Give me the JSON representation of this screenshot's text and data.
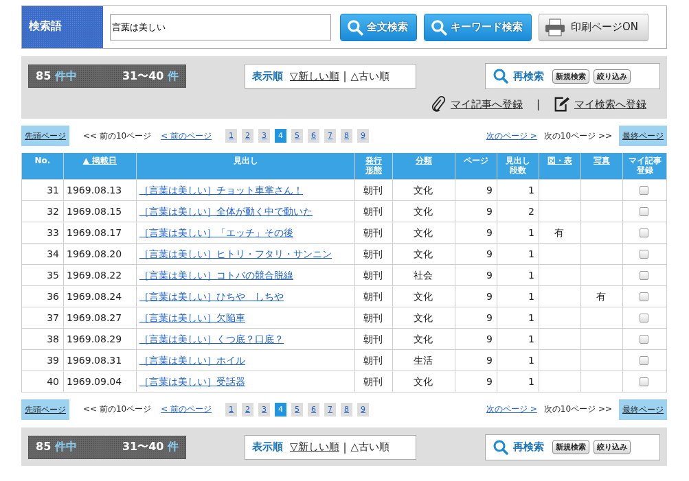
{
  "search": {
    "label": "検索語",
    "value": "言葉は美しい",
    "buttons": [
      {
        "kind": "search",
        "label": "全文検索"
      },
      {
        "kind": "search",
        "label": "キーワード検索"
      },
      {
        "kind": "print",
        "label": "印刷ページON"
      }
    ]
  },
  "result_bars": [
    {
      "total": "85",
      "total_unit": "件中",
      "range": "31〜40",
      "range_unit": "件",
      "sort_label": "表示順",
      "sort_options": [
        {
          "label": "▽新しい順",
          "selected": false
        },
        {
          "label": "△古い順",
          "selected": true
        }
      ],
      "sort_separator": "|",
      "research_label": "再検索",
      "research_buttons": [
        "新規検索",
        "絞り込み"
      ],
      "register_links": [
        {
          "kind": "clip",
          "label": "マイ記事へ登録"
        },
        {
          "kind": "note",
          "label": "マイ検索へ登録"
        }
      ],
      "register_separator": "|"
    },
    {
      "total": "85",
      "total_unit": "件中",
      "range": "31〜40",
      "range_unit": "件",
      "sort_label": "表示順",
      "sort_options": [
        {
          "label": "▽新しい順",
          "selected": false
        },
        {
          "label": "△古い順",
          "selected": true
        }
      ],
      "sort_separator": "|",
      "research_label": "再検索",
      "research_buttons": [
        "新規検索",
        "絞り込み"
      ]
    }
  ],
  "pagers": [
    {
      "first": "先頭ページ",
      "prev10": "<< 前の10ページ",
      "prev": "< 前のページ",
      "pages": [
        {
          "label": "1",
          "selected": false
        },
        {
          "label": "2",
          "selected": false
        },
        {
          "label": "3",
          "selected": false
        },
        {
          "label": "4",
          "selected": true
        },
        {
          "label": "5",
          "selected": false
        },
        {
          "label": "6",
          "selected": false
        },
        {
          "label": "7",
          "selected": false
        },
        {
          "label": "8",
          "selected": false
        },
        {
          "label": "9",
          "selected": false
        }
      ],
      "next": "次のページ >",
      "next10": "次の10ページ >>",
      "last": "最終ページ"
    },
    {
      "first": "先頭ページ",
      "prev10": "<< 前の10ページ",
      "prev": "< 前のページ",
      "pages": [
        {
          "label": "1",
          "selected": false
        },
        {
          "label": "2",
          "selected": false
        },
        {
          "label": "3",
          "selected": false
        },
        {
          "label": "4",
          "selected": true
        },
        {
          "label": "5",
          "selected": false
        },
        {
          "label": "6",
          "selected": false
        },
        {
          "label": "7",
          "selected": false
        },
        {
          "label": "8",
          "selected": false
        },
        {
          "label": "9",
          "selected": false
        }
      ],
      "next": "次のページ >",
      "next10": "次の10ページ >>",
      "last": "最終ページ"
    }
  ],
  "table": {
    "columns": [
      {
        "label": "No.",
        "sortable": false
      },
      {
        "label": "▲ 掲載日",
        "sortable": true
      },
      {
        "label": "見出し",
        "sortable": false
      },
      {
        "label": "発行形態",
        "sortable": true
      },
      {
        "label": "分類",
        "sortable": true
      },
      {
        "label": "ページ",
        "sortable": false
      },
      {
        "label": "見出し段数",
        "sortable": false
      },
      {
        "label": "図・表",
        "sortable": true
      },
      {
        "label": "写真",
        "sortable": true
      },
      {
        "label": "マイ記事登録",
        "sortable": false
      }
    ],
    "rows": [
      {
        "no": "31",
        "date": "1969.08.13",
        "title": "［言葉は美しい］チョット車掌さん！",
        "edition": "朝刊",
        "category": "文化",
        "page": "9",
        "columns": "1",
        "figure": "",
        "photo": "",
        "checked": false
      },
      {
        "no": "32",
        "date": "1969.08.15",
        "title": "［言葉は美しい］全体が動く中で動いた",
        "edition": "朝刊",
        "category": "文化",
        "page": "9",
        "columns": "2",
        "figure": "",
        "photo": "",
        "checked": false
      },
      {
        "no": "33",
        "date": "1969.08.17",
        "title": "［言葉は美しい］「エッチ」その後",
        "edition": "朝刊",
        "category": "文化",
        "page": "9",
        "columns": "1",
        "figure": "有",
        "photo": "",
        "checked": false
      },
      {
        "no": "34",
        "date": "1969.08.20",
        "title": "［言葉は美しい］ヒトリ・フタリ・サンニン",
        "edition": "朝刊",
        "category": "文化",
        "page": "9",
        "columns": "1",
        "figure": "",
        "photo": "",
        "checked": false
      },
      {
        "no": "35",
        "date": "1969.08.22",
        "title": "［言葉は美しい］コトバの競合脱線",
        "edition": "朝刊",
        "category": "社会",
        "page": "9",
        "columns": "1",
        "figure": "",
        "photo": "",
        "checked": false
      },
      {
        "no": "36",
        "date": "1969.08.24",
        "title": "［言葉は美しい］ひちや　しちや",
        "edition": "朝刊",
        "category": "文化",
        "page": "9",
        "columns": "1",
        "figure": "",
        "photo": "有",
        "checked": false
      },
      {
        "no": "37",
        "date": "1969.08.27",
        "title": "［言葉は美しい］欠陥車",
        "edition": "朝刊",
        "category": "文化",
        "page": "9",
        "columns": "1",
        "figure": "",
        "photo": "",
        "checked": false
      },
      {
        "no": "38",
        "date": "1969.08.29",
        "title": "［言葉は美しい］くつ底？口底？",
        "edition": "朝刊",
        "category": "文化",
        "page": "9",
        "columns": "1",
        "figure": "",
        "photo": "",
        "checked": false
      },
      {
        "no": "39",
        "date": "1969.08.31",
        "title": "［言葉は美しい］ホイル",
        "edition": "朝刊",
        "category": "生活",
        "page": "9",
        "columns": "1",
        "figure": "",
        "photo": "",
        "checked": false
      },
      {
        "no": "40",
        "date": "1969.09.04",
        "title": "［言葉は美しい］受話器",
        "edition": "朝刊",
        "category": "文化",
        "page": "9",
        "columns": "1",
        "figure": "",
        "photo": "",
        "checked": false
      }
    ]
  }
}
